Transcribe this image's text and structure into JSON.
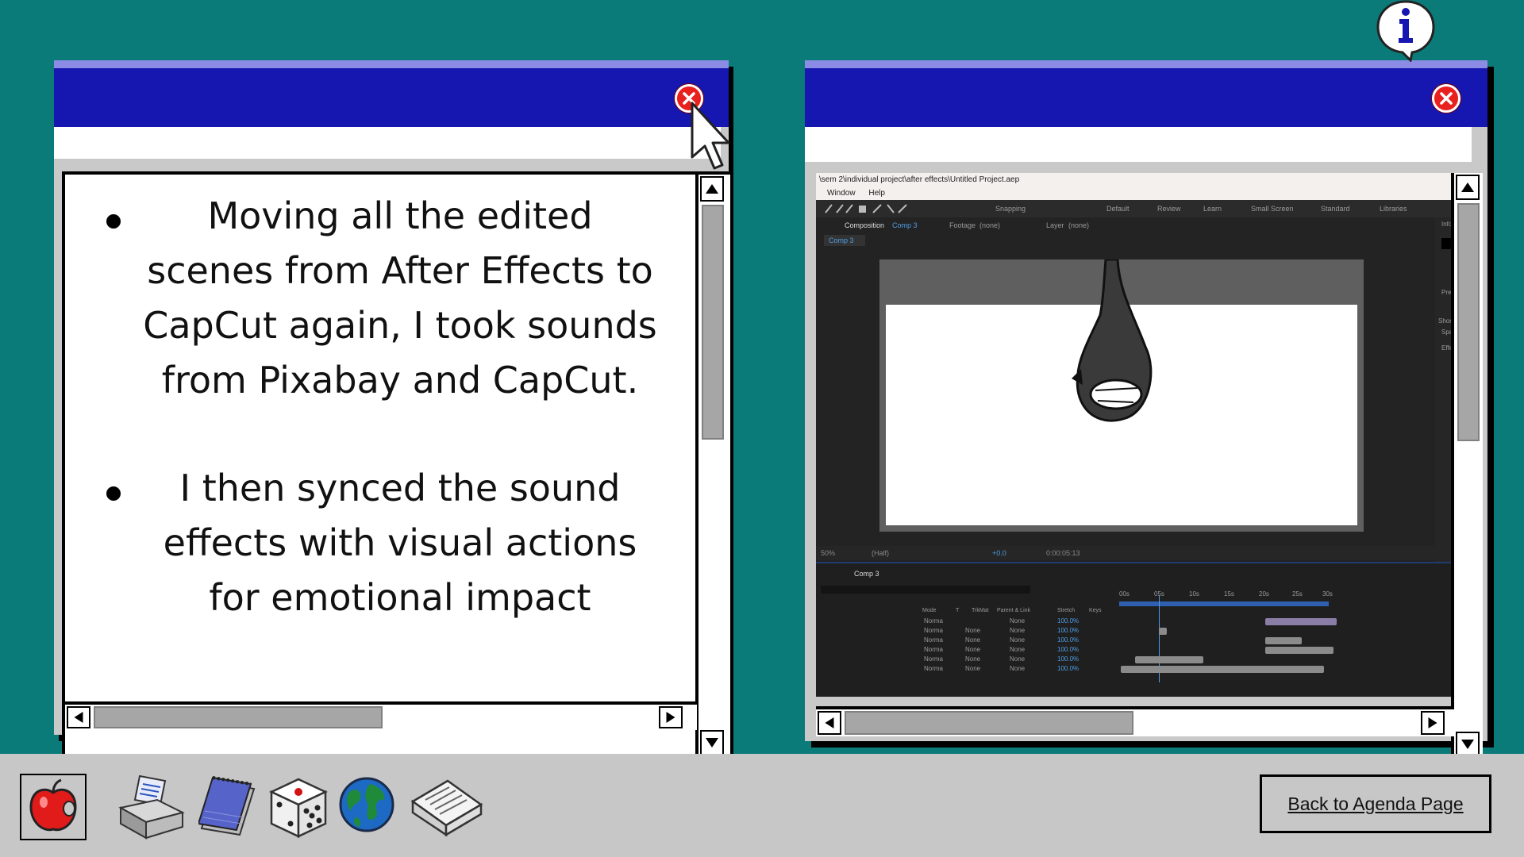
{
  "left_window": {
    "bullets": [
      {
        "lines": [
          "Moving all the edited",
          "scenes from After Effects to",
          "CapCut again, I took sounds",
          "from Pixabay and CapCut."
        ]
      },
      {
        "lines": [
          "I then synced the sound",
          "effects with visual actions",
          "for emotional impact"
        ]
      }
    ]
  },
  "ae_screenshot": {
    "path": "\\sem 2\\individual project\\after effects\\Untitled Project.aep",
    "menu": [
      "Window",
      "Help"
    ],
    "toolbar_snapping": "Snapping",
    "workspaces": [
      "Default",
      "Review",
      "Learn",
      "Small Screen",
      "Standard",
      "Libraries"
    ],
    "panel_composition": "Composition",
    "panel_comp_name": "Comp 3",
    "panel_footage": "Footage",
    "panel_footage_value": "(none)",
    "panel_layer": "Layer",
    "panel_layer_value": "(none)",
    "sub_tab": "Comp 3",
    "zoom": "50%",
    "resolution": "(Half)",
    "exposure": "+0.0",
    "timecode": "0:00:05:13",
    "right_panel": [
      "Info",
      "Pre",
      "Shor",
      "Spa",
      "Effe"
    ],
    "timeline_tab": "Comp 3",
    "ruler": [
      "00s",
      "05s",
      "10s",
      "15s",
      "20s",
      "25s",
      "30s"
    ],
    "col_headers": {
      "mode": "Mode",
      "t": "T",
      "trkmat": "TrkMat",
      "parent": "Parent & Link",
      "stretch": "Stretch",
      "keys": "Keys"
    },
    "layers": [
      {
        "mode": "Norma",
        "trkmat": "",
        "parent": "None",
        "stretch": "100.0%"
      },
      {
        "mode": "Norma",
        "trkmat": "None",
        "parent": "None",
        "stretch": "100.0%"
      },
      {
        "mode": "Norma",
        "trkmat": "None",
        "parent": "None",
        "stretch": "100.0%"
      },
      {
        "mode": "Norma",
        "trkmat": "None",
        "parent": "None",
        "stretch": "100.0%"
      },
      {
        "mode": "Norma",
        "trkmat": "None",
        "parent": "None",
        "stretch": "100.0%"
      },
      {
        "mode": "Norma",
        "trkmat": "None",
        "parent": "None",
        "stretch": "100.0%"
      }
    ]
  },
  "taskbar": {
    "icons": [
      "apple-icon",
      "printer-icon",
      "notepad-icon",
      "dice-icon",
      "globe-icon",
      "typewriter-icon"
    ],
    "agenda_button": "Back to Agenda Page"
  },
  "colors": {
    "desktop": "#0b7b79",
    "titlebar": "#1616b0",
    "close": "#e8211f",
    "taskbar": "#c7c7c7"
  }
}
